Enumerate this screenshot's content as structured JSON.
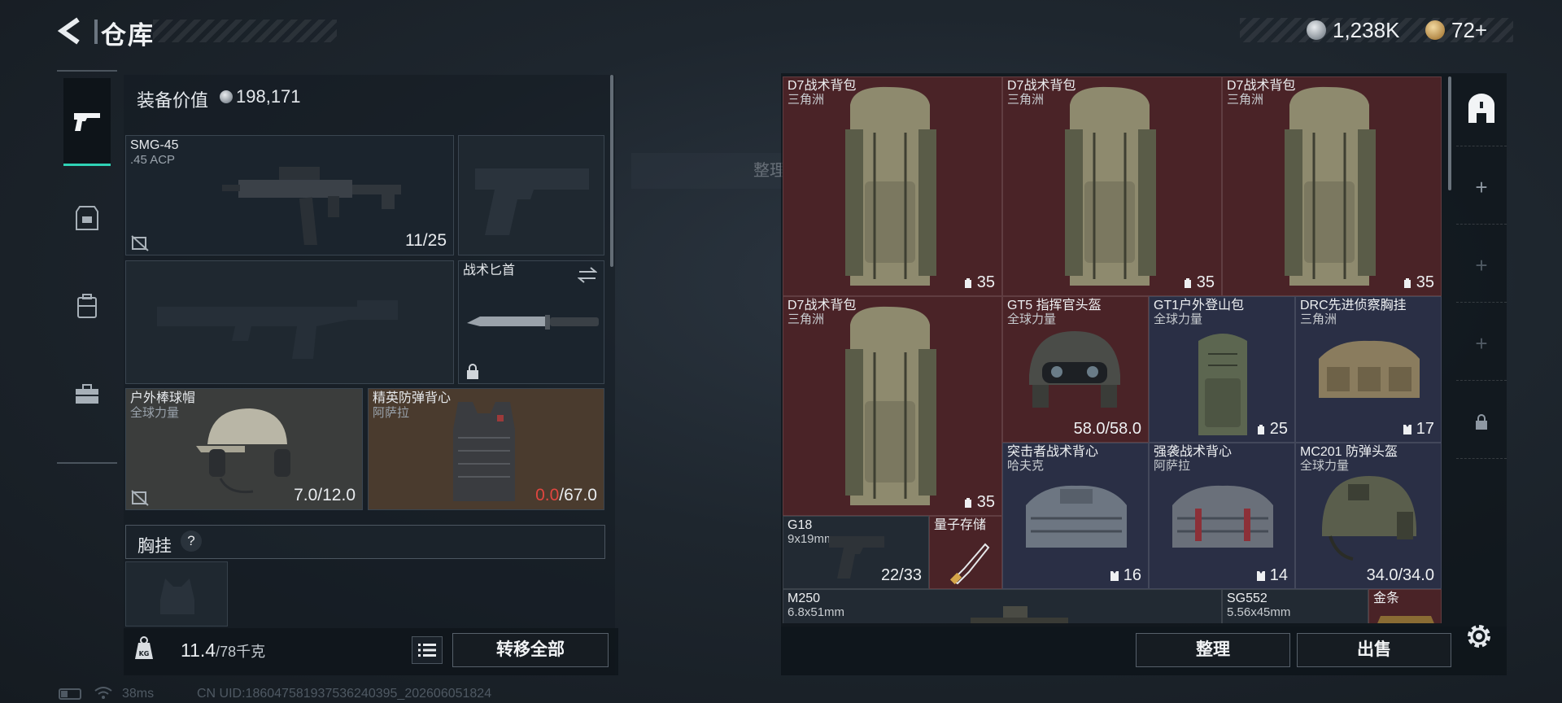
{
  "header": {
    "title": "仓库",
    "currency_silver": "1,238K",
    "currency_gold": "72+"
  },
  "loadout": {
    "value_label": "装备价值",
    "value": "198,171",
    "primary": {
      "name": "SMG-45",
      "sub": ".45 ACP",
      "durability": "11/25"
    },
    "melee": {
      "name": "战术匕首"
    },
    "helmet": {
      "name": "户外棒球帽",
      "sub": "全球力量",
      "durability": "7.0/12.0"
    },
    "armor": {
      "name": "精英防弹背心",
      "sub": "阿萨拉",
      "durability_current": "0.0",
      "durability_max": "/67.0"
    },
    "chest_rig_title": "胸挂",
    "help": "?",
    "weight": "11.4",
    "weight_max": "/78千克",
    "transfer_all": "转移全部"
  },
  "toast": "整理成功",
  "storage": {
    "items": [
      {
        "name": "D7战术背包",
        "sub": "三角洲",
        "count": "35"
      },
      {
        "name": "D7战术背包",
        "sub": "三角洲",
        "count": "35"
      },
      {
        "name": "D7战术背包",
        "sub": "三角洲",
        "count": "35"
      },
      {
        "name": "D7战术背包",
        "sub": "三角洲",
        "count": "35"
      },
      {
        "name": "GT5 指挥官头盔",
        "sub": "全球力量",
        "count": "58.0/58.0"
      },
      {
        "name": "GT1户外登山包",
        "sub": "全球力量",
        "count": "25"
      },
      {
        "name": "DRC先进侦察胸挂",
        "sub": "三角洲",
        "count": "17"
      },
      {
        "name": "突击者战术背心",
        "sub": "哈夫克",
        "count": "16"
      },
      {
        "name": "强袭战术背心",
        "sub": "阿萨拉",
        "count": "14"
      },
      {
        "name": "MC201 防弹头盔",
        "sub": "全球力量",
        "count": "34.0/34.0"
      },
      {
        "name": "G18",
        "sub": "9x19mm",
        "count": "22/33"
      },
      {
        "name": "量子存储"
      },
      {
        "name": "M250",
        "sub": "6.8x51mm"
      },
      {
        "name": "SG552",
        "sub": "5.56x45mm"
      },
      {
        "name": "金条"
      }
    ],
    "sort": "整理",
    "sell": "出售"
  },
  "status": {
    "ping": "38ms",
    "uid": "CN UID:1860475819375362403​95_202606051824"
  },
  "colors": {
    "accent": "#2fd2b5",
    "warning": "#e0463f",
    "cell_red": "#4a2327",
    "cell_navy": "#2a2f45"
  }
}
